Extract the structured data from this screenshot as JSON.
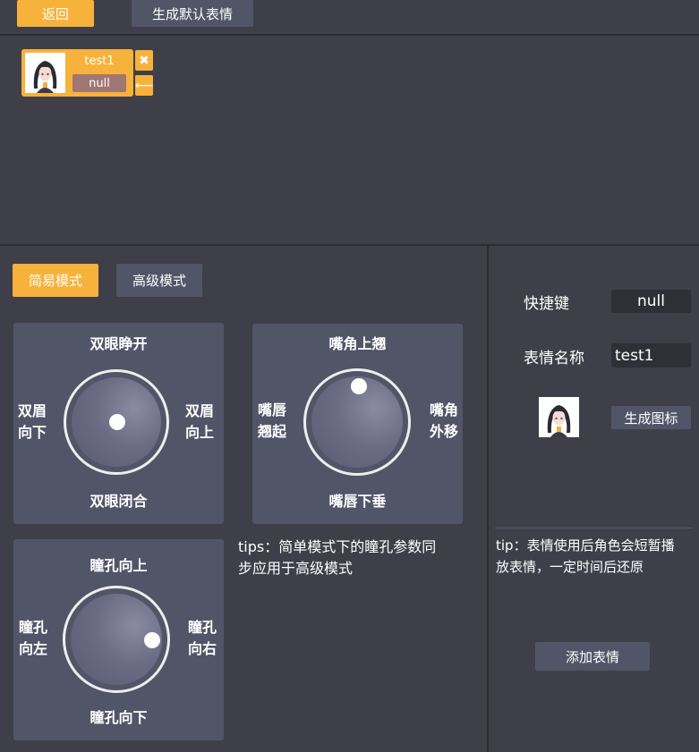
{
  "toolbar": {
    "back_label": "返回",
    "generate_default_label": "生成默认表情"
  },
  "expression_card": {
    "name": "test1",
    "hotkey": "null",
    "delete_icon": "close-icon",
    "apply_icon": "arrow-left-icon"
  },
  "modes": {
    "simple_label": "简易模式",
    "advanced_label": "高级模式",
    "active": "simple"
  },
  "eyes_panel": {
    "top": "双眼睁开",
    "bottom": "双眼闭合",
    "left_line1": "双眉",
    "left_line2": "向下",
    "right_line1": "双眉",
    "right_line2": "向上"
  },
  "mouth_panel": {
    "top": "嘴角上翘",
    "bottom": "嘴唇下垂",
    "left_line1": "嘴唇",
    "left_line2": "翘起",
    "right_line1": "嘴角",
    "right_line2": "外移"
  },
  "pupil_panel": {
    "top": "瞳孔向上",
    "bottom": "瞳孔向下",
    "left_line1": "瞳孔",
    "left_line2": "向左",
    "right_line1": "瞳孔",
    "right_line2": "向右"
  },
  "tips": {
    "line1": "tips：简单模式下的瞳孔参数同",
    "line2": "步应用于高级模式"
  },
  "settings": {
    "hotkey_label": "快捷键",
    "hotkey_value": "null",
    "name_label": "表情名称",
    "name_value": "test1",
    "generate_icon_label": "生成图标",
    "tip_line1": "tip：表情使用后角色会短暂播",
    "tip_line2": "放表情，一定时间后还原",
    "add_label": "添加表情"
  },
  "colors": {
    "accent": "#f7b23b",
    "panel": "#525568",
    "background": "#3f3f4a",
    "hotkey_badge": "#a07773"
  }
}
